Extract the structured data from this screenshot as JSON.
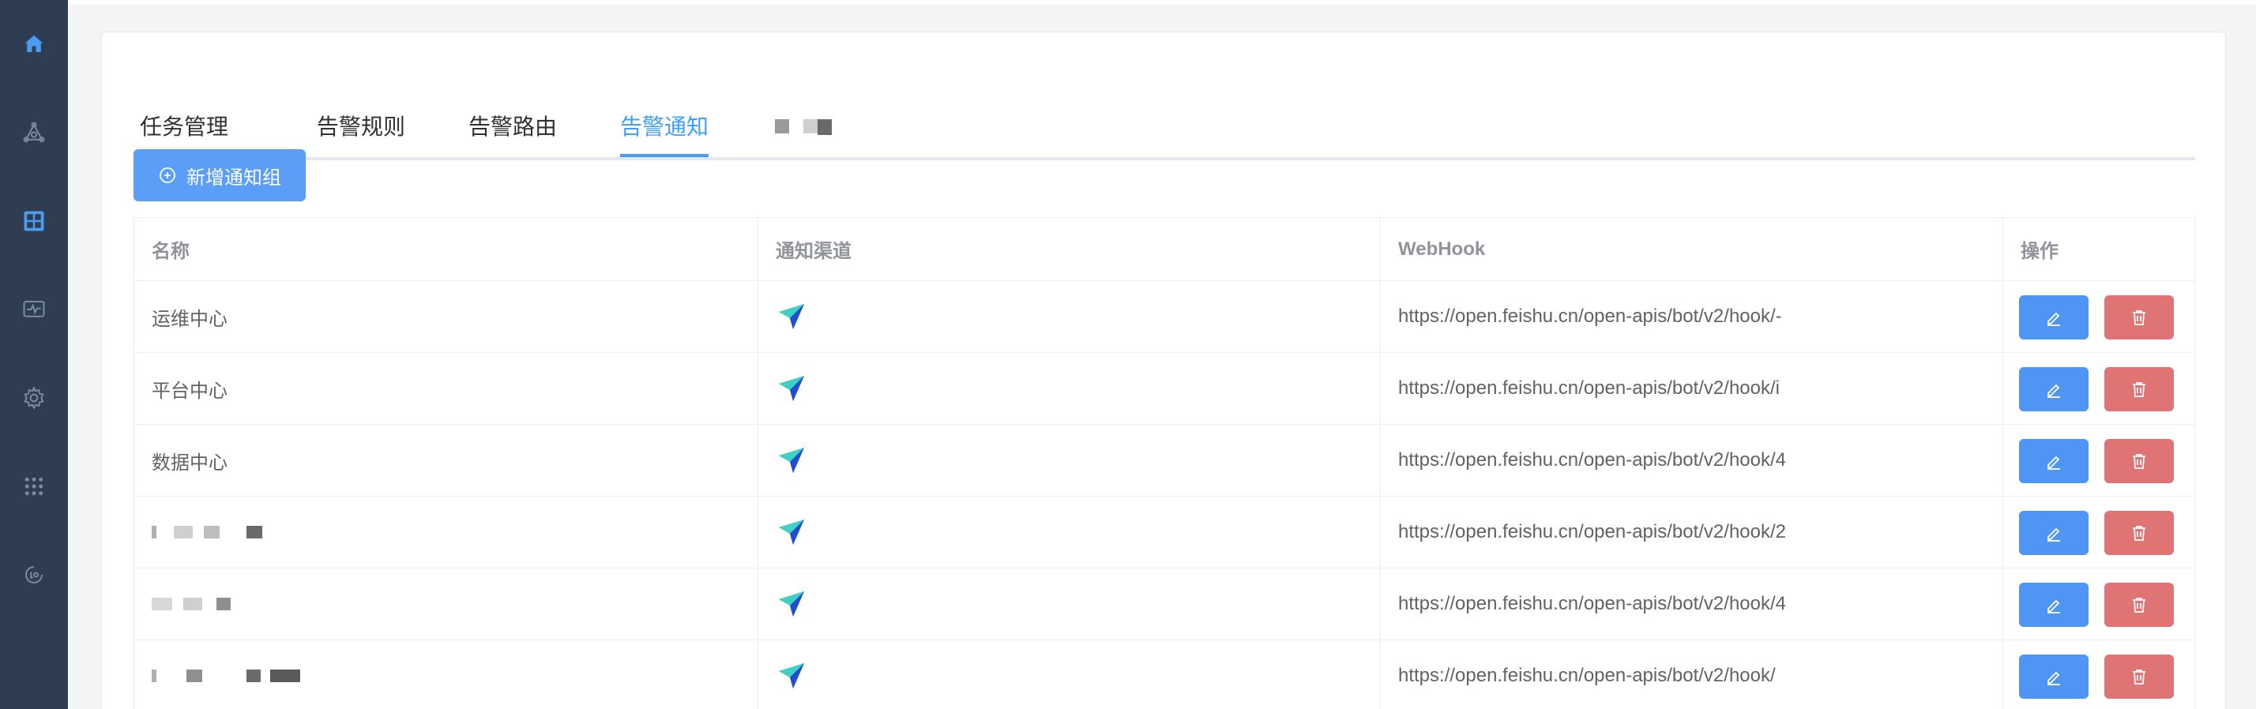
{
  "colors": {
    "sidebar_bg": "#2f3d52",
    "sidebar_active": "#4a9cf0",
    "sidebar_icon": "#7a8aa2",
    "accent": "#409eff",
    "edit_button": "#4f95f4",
    "delete_button": "#e07474"
  },
  "sidebar": {
    "items": [
      {
        "icon": "home-icon",
        "active": true
      },
      {
        "icon": "triangle-network-icon",
        "active": false
      },
      {
        "icon": "dashboard-grid-icon",
        "active": true
      },
      {
        "icon": "monitor-pulse-icon",
        "active": false
      },
      {
        "icon": "settings-gear-icon",
        "active": false
      },
      {
        "icon": "apps-dots-icon",
        "active": false
      },
      {
        "icon": "log-icon",
        "active": false
      }
    ]
  },
  "tabs": [
    {
      "label": "任务管理",
      "active": false
    },
    {
      "label": "告警规则",
      "active": false
    },
    {
      "label": "告警路由",
      "active": false
    },
    {
      "label": "告警通知",
      "active": true
    }
  ],
  "toolbar": {
    "add_label": "新增通知组"
  },
  "table": {
    "columns": [
      "名称",
      "通知渠道",
      "WebHook",
      "操作"
    ],
    "rows": [
      {
        "name": "运维中心",
        "channel": "feishu-icon",
        "webhook": "https://open.feishu.cn/open-apis/bot/v2/hook/-"
      },
      {
        "name": "平台中心",
        "channel": "feishu-icon",
        "webhook": "https://open.feishu.cn/open-apis/bot/v2/hook/i"
      },
      {
        "name": "数据中心",
        "channel": "feishu-icon",
        "webhook": "https://open.feishu.cn/open-apis/bot/v2/hook/4"
      },
      {
        "name": "",
        "channel": "feishu-icon",
        "webhook": "https://open.feishu.cn/open-apis/bot/v2/hook/2"
      },
      {
        "name": "",
        "channel": "feishu-icon",
        "webhook": "https://open.feishu.cn/open-apis/bot/v2/hook/4"
      },
      {
        "name": "",
        "channel": "feishu-icon",
        "webhook": "https://open.feishu.cn/open-apis/bot/v2/hook/"
      }
    ]
  }
}
